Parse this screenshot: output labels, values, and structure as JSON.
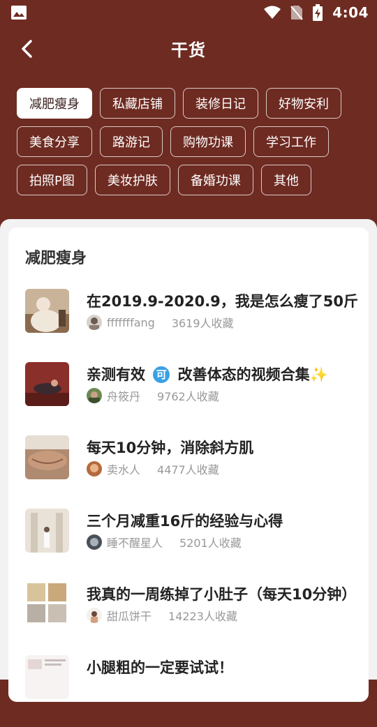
{
  "status": {
    "time": "4:04"
  },
  "header": {
    "title": "干货"
  },
  "tags": [
    [
      "减肥瘦身",
      "私藏店铺",
      "装修日记",
      "好物安利"
    ],
    [
      "美食分享",
      "路游记",
      "购物功课",
      "学习工作"
    ],
    [
      "拍照P图",
      "美妆护肤",
      "备婚功课",
      "其他"
    ]
  ],
  "active_tag": "减肥瘦身",
  "section": {
    "title": "减肥瘦身"
  },
  "items": [
    {
      "title": "在2019.9-2020.9，我是怎么瘦了50斤",
      "author": "fffffffang",
      "favorites": "3619人收藏"
    },
    {
      "title_parts": [
        "亲测有效 ",
        "可",
        " 改善体态的视频合集",
        "✨"
      ],
      "author": "舟筱丹",
      "favorites": "9762人收藏"
    },
    {
      "title": "每天10分钟，消除斜方肌",
      "author": "卖水人",
      "favorites": "4477人收藏"
    },
    {
      "title": "三个月减重16斤的经验与心得",
      "author": "睡不醒星人",
      "favorites": "5201人收藏"
    },
    {
      "title": "我真的一周练掉了小肚子（每天10分钟）",
      "author": "甜瓜饼干",
      "favorites": "14223人收藏"
    },
    {
      "title": "小腿粗的一定要试试！",
      "author": "",
      "favorites": ""
    }
  ],
  "colors": {
    "header_bg": "#6e2b22",
    "panel_bg": "#f2f2f2"
  }
}
